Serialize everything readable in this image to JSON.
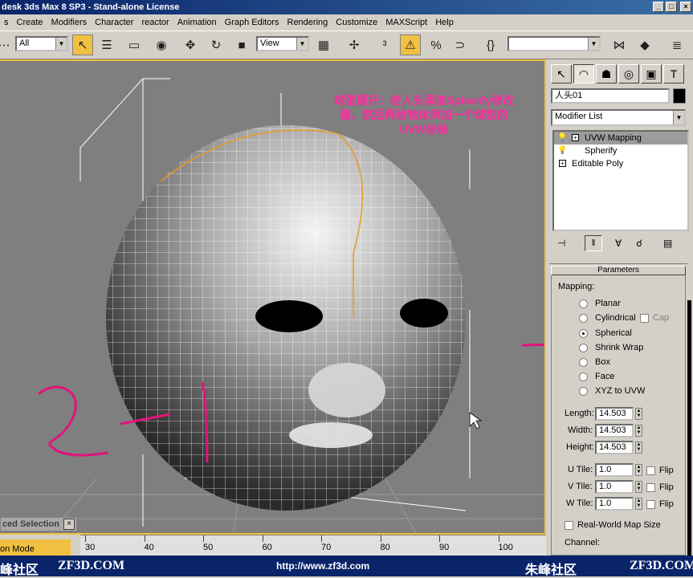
{
  "titlebar": {
    "title": "desk 3ds Max 8 SP3  - Stand-alone License",
    "buttons": [
      "_",
      "□",
      "×"
    ]
  },
  "menu": [
    "s",
    "Create",
    "Modifiers",
    "Character",
    "reactor",
    "Animation",
    "Graph Editors",
    "Rendering",
    "Customize",
    "MAXScript",
    "Help"
  ],
  "toolbar": {
    "selection_filter": "All",
    "reference_coord": "View",
    "named_selection": ""
  },
  "viewport": {
    "annotation": "球型展开：给人头添加Spherify修改器，然后再给物体添加一个球型的UVW坐标",
    "handwriting": "2-1",
    "colors": {
      "background": "#7f7f7f",
      "annotation": "#ff2aa0",
      "border_active": "#f0c040"
    }
  },
  "panel": {
    "object_name": "人头01",
    "modifier_list_label": "Modifier List",
    "stack": [
      {
        "label": "UVW Mapping",
        "selected": true,
        "expandable": true
      },
      {
        "label": "Spherify",
        "selected": false,
        "expandable": false
      },
      {
        "label": "Editable Poly",
        "selected": false,
        "expandable": true
      }
    ],
    "rollout_title": "Parameters",
    "mapping_group": "Mapping:",
    "mapping_options": [
      "Planar",
      "Cylindrical",
      "Spherical",
      "Shrink Wrap",
      "Box",
      "Face",
      "XYZ to UVW"
    ],
    "mapping_selected": "Spherical",
    "cap_label": "Cap",
    "length_label": "Length:",
    "length_value": "14.503",
    "width_label": "Width:",
    "width_value": "14.503",
    "height_label": "Height:",
    "height_value": "14.503",
    "utile_label": "U Tile:",
    "utile_value": "1.0",
    "vtile_label": "V Tile:",
    "vtile_value": "1.0",
    "wtile_label": "W Tile:",
    "wtile_value": "1.0",
    "flip_label": "Flip",
    "realworld_label": "Real-World Map Size",
    "channel_label": "Channel:"
  },
  "bottom": {
    "selection_title": "ced Selection",
    "mode_label": "on Mode",
    "ruler_ticks": [
      "30",
      "40",
      "50",
      "60",
      "70",
      "80",
      "90",
      "100"
    ]
  },
  "footer": {
    "left": "峰社区",
    "brand1": "ZF3D.COM",
    "url": "http://www.zf3d.com",
    "brand2": "朱峰社区",
    "brand3": "ZF3D.COM"
  }
}
